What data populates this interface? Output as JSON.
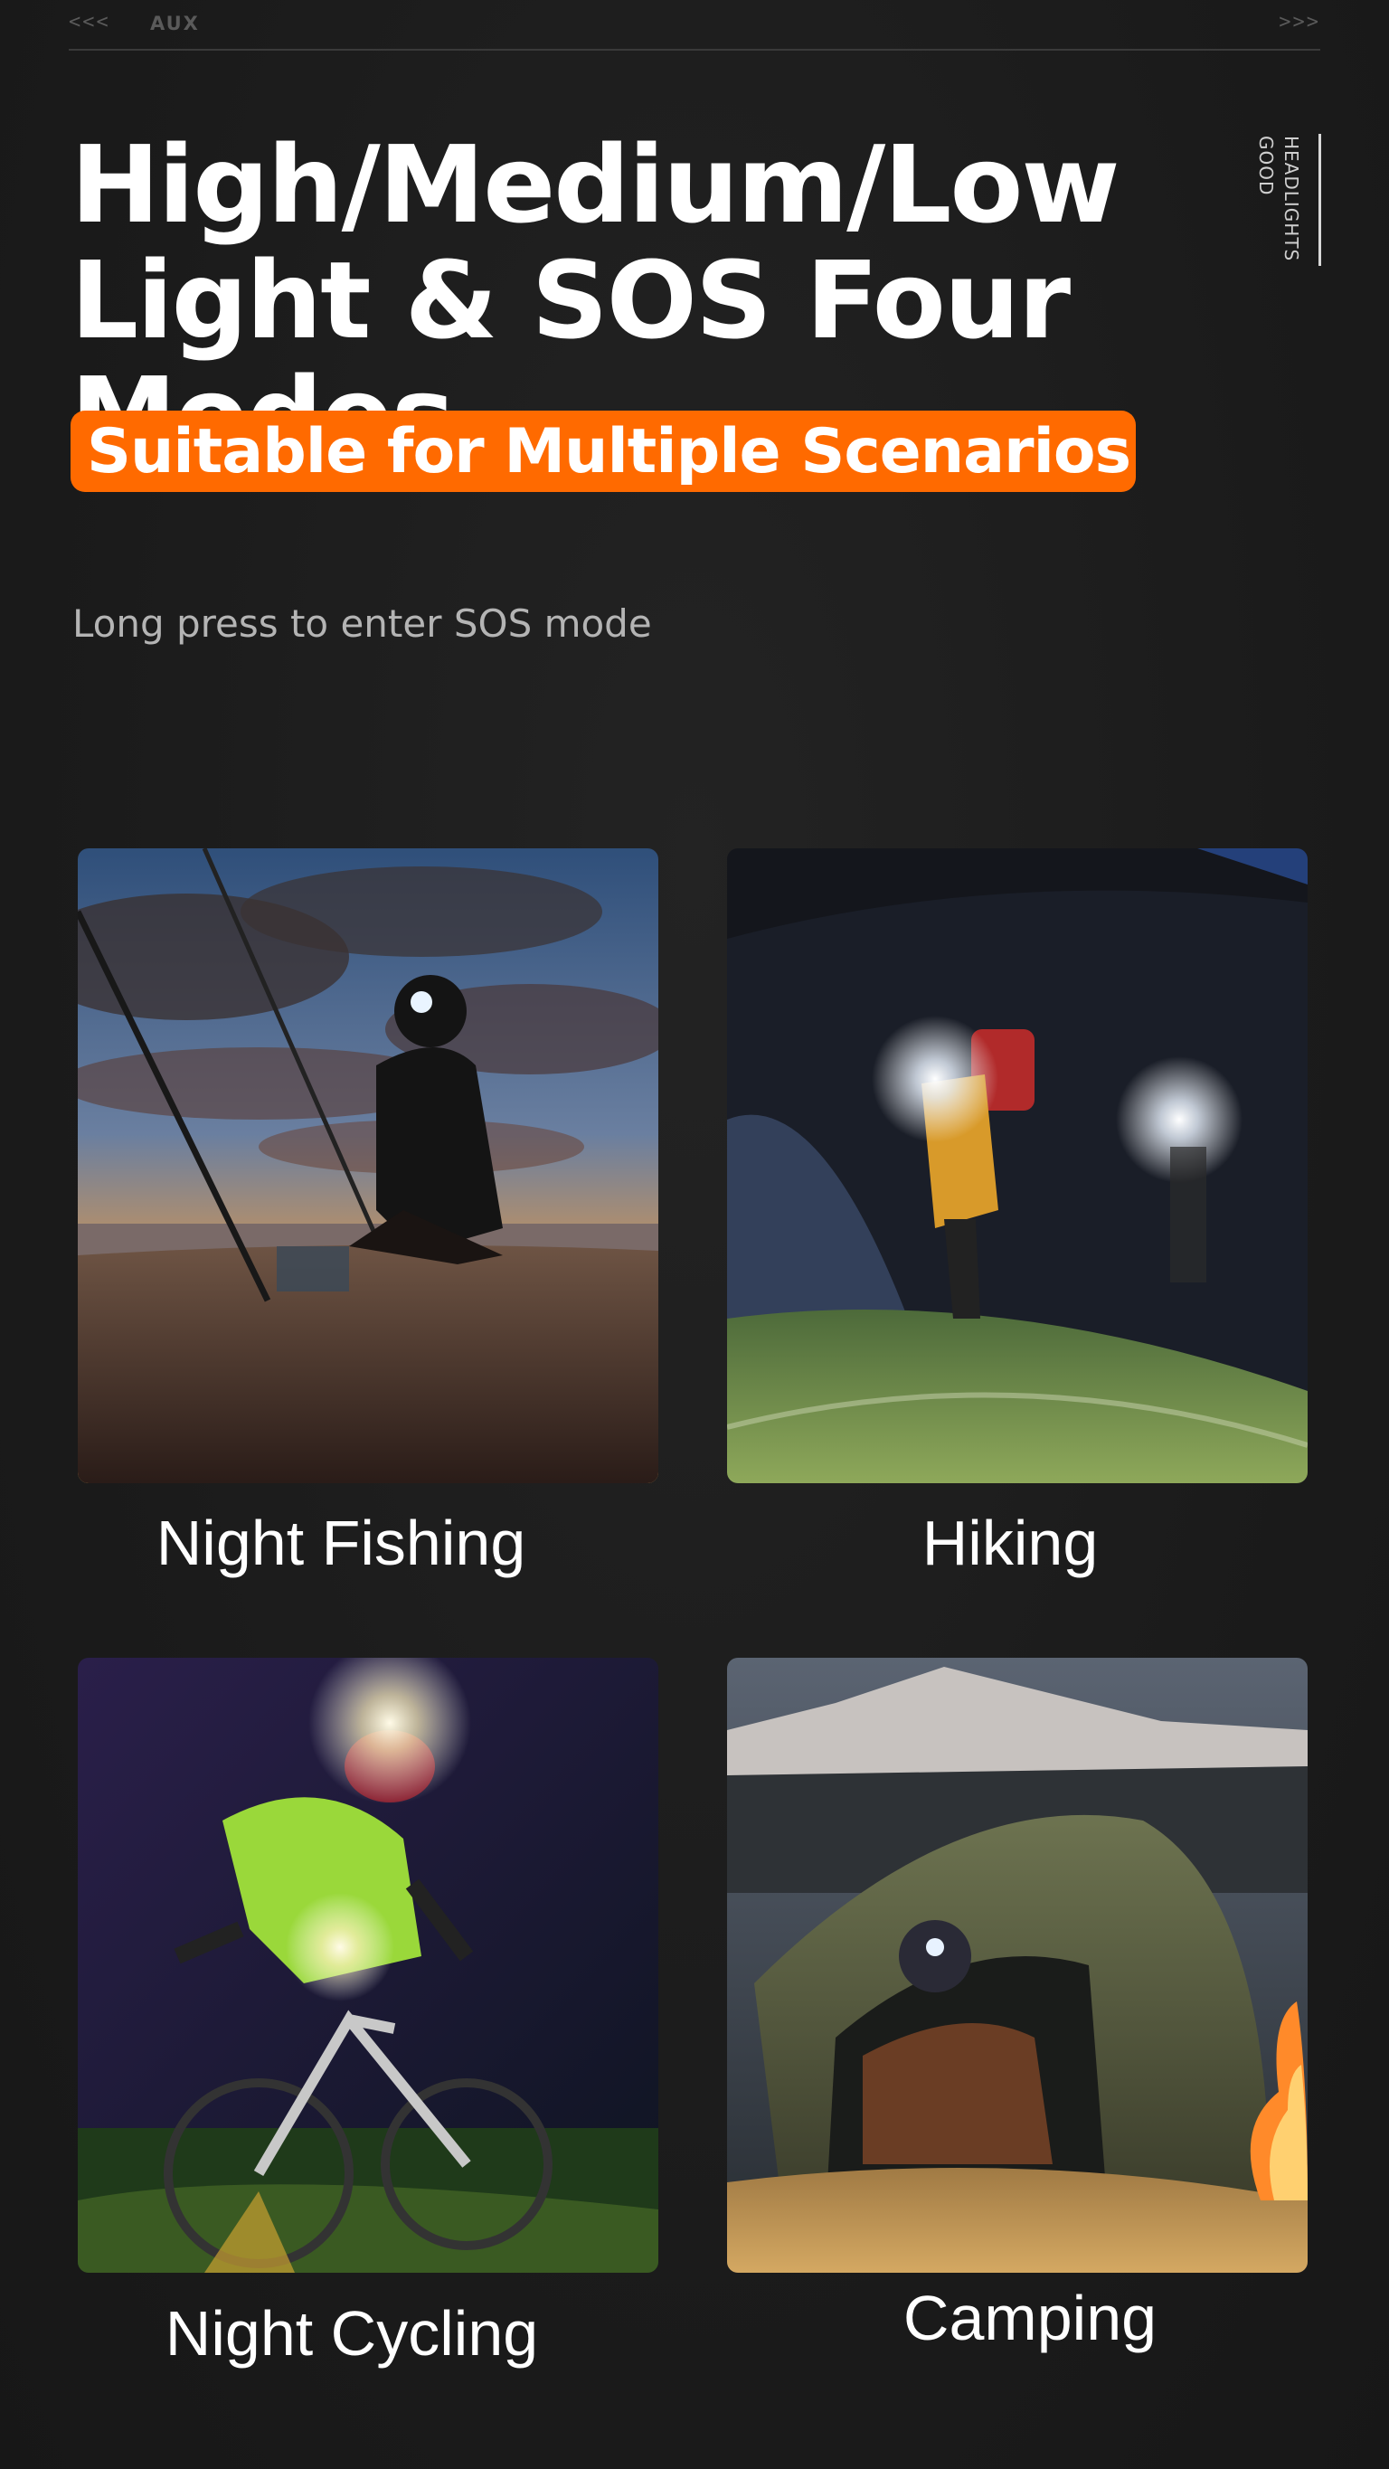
{
  "header": {
    "arrows_left": "<<<",
    "brand": "AUX",
    "arrows_right": ">>>",
    "side_tag_line1": "HEADLIGHTS",
    "side_tag_line2": "GOOD"
  },
  "title": {
    "line1": "High/Medium/Low",
    "line2": "Light & SOS Four Modes"
  },
  "subtitle": "Suitable for Multiple Scenarios",
  "note": "Long press to enter SOS mode",
  "scenarios": [
    {
      "label": "Night Fishing"
    },
    {
      "label": "Hiking"
    },
    {
      "label": "Night Cycling"
    },
    {
      "label": "Camping"
    }
  ],
  "colors": {
    "accent": "#ff6a00",
    "background": "#1c1c1c",
    "text": "#ffffff",
    "muted": "#b4b4b4"
  }
}
